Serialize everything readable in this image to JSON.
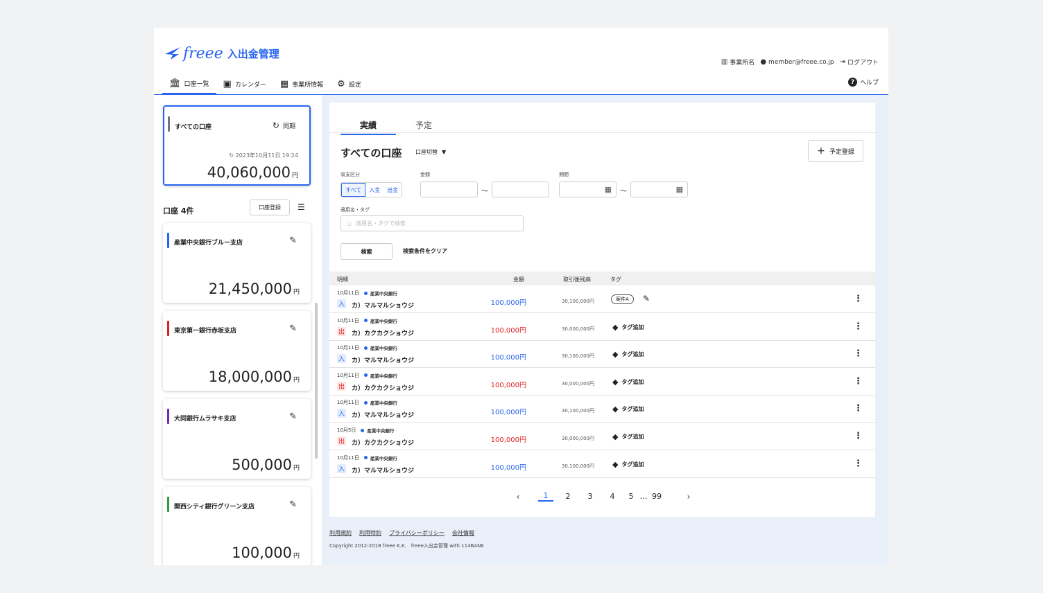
{
  "brand": {
    "word": "freee",
    "title": "入出金管理"
  },
  "header": {
    "office": "事業所名",
    "user": "member@freee.co.jp",
    "logout": "ログアウト",
    "help": "ヘルプ"
  },
  "nav": [
    {
      "label": "口座一覧",
      "icon": "bank-icon"
    },
    {
      "label": "カレンダー",
      "icon": "calendar-icon"
    },
    {
      "label": "事業所情報",
      "icon": "building-icon"
    },
    {
      "label": "設定",
      "icon": "gear-icon"
    }
  ],
  "all_account": {
    "name": "すべての口座",
    "sync": "同期",
    "updated": "2023年10月11日 19:24",
    "amount": "40,060,000",
    "unit": "円"
  },
  "accounts_header": {
    "title": "口座 4件",
    "register": "口座登録"
  },
  "accounts": [
    {
      "name": "産業中央銀行ブルー支店",
      "amount": "21,450,000",
      "color": "#2864f0"
    },
    {
      "name": "東京第一銀行赤坂支店",
      "amount": "18,000,000",
      "color": "#e02020"
    },
    {
      "name": "大同銀行ムラサキ支店",
      "amount": "500,000",
      "color": "#6a2bb0"
    },
    {
      "name": "関西シティ銀行グリーン支店",
      "amount": "100,000",
      "color": "#2e9a3a"
    }
  ],
  "tabs": [
    "実績",
    "予定"
  ],
  "main": {
    "title": "すべての口座",
    "switch": "口座切替",
    "add_plan": "予定登録",
    "filter": {
      "type_label": "収支区分",
      "types": [
        "すべて",
        "入金",
        "出金"
      ],
      "amount_label": "金額",
      "period_label": "期間",
      "tilde": "〜",
      "tag_label": "適用名・タグ",
      "tag_placeholder": "適用名・タグで検索",
      "search": "検索",
      "clear": "検索条件をクリア"
    }
  },
  "table": {
    "headers": {
      "detail": "明細",
      "amount": "金額",
      "balance": "取引後残高",
      "tag": "タグ"
    },
    "rows": [
      {
        "date": "10月11日",
        "bank": "産業中央銀行",
        "kind": "入",
        "dir": "in",
        "payee": "カ）マルマルショウジ",
        "amount": "100,000円",
        "balance": "30,100,000円",
        "tag": "案件A",
        "has_chip": true
      },
      {
        "date": "10月11日",
        "bank": "産業中央銀行",
        "kind": "出",
        "dir": "out",
        "payee": "カ）カクカクショウジ",
        "amount": "100,000円",
        "balance": "30,000,000円",
        "tag": "タグ追加",
        "has_chip": false
      },
      {
        "date": "10月11日",
        "bank": "産業中央銀行",
        "kind": "入",
        "dir": "in",
        "payee": "カ）マルマルショウジ",
        "amount": "100,000円",
        "balance": "30,100,000円",
        "tag": "タグ追加",
        "has_chip": false
      },
      {
        "date": "10月11日",
        "bank": "産業中央銀行",
        "kind": "出",
        "dir": "out",
        "payee": "カ）カクカクショウジ",
        "amount": "100,000円",
        "balance": "30,000,000円",
        "tag": "タグ追加",
        "has_chip": false
      },
      {
        "date": "10月11日",
        "bank": "産業中央銀行",
        "kind": "入",
        "dir": "in",
        "payee": "カ）マルマルショウジ",
        "amount": "100,000円",
        "balance": "30,100,000円",
        "tag": "タグ追加",
        "has_chip": false
      },
      {
        "date": "10月5日",
        "bank": "産業中央銀行",
        "kind": "出",
        "dir": "out",
        "payee": "カ）カクカクショウジ",
        "amount": "100,000円",
        "balance": "30,000,000円",
        "tag": "タグ追加",
        "has_chip": false
      },
      {
        "date": "10月11日",
        "bank": "産業中央銀行",
        "kind": "入",
        "dir": "in",
        "payee": "カ）マルマルショウジ",
        "amount": "100,000円",
        "balance": "30,100,000円",
        "tag": "タグ追加",
        "has_chip": false
      }
    ]
  },
  "pagination": {
    "pages": [
      "1",
      "2",
      "3",
      "4",
      "5"
    ],
    "ellipsis": "…",
    "last": "99",
    "current": "1"
  },
  "footer": {
    "links": [
      "利用規約",
      "利用特約",
      "プライバシーポリシー",
      "会社情報"
    ],
    "copyright": "Copyright 2012-2018 freee K.K.　freee入出金管理 with 114BANK"
  },
  "colors": {
    "accent": "#2864f0",
    "income": "#2864f0",
    "expense": "#e02020"
  }
}
